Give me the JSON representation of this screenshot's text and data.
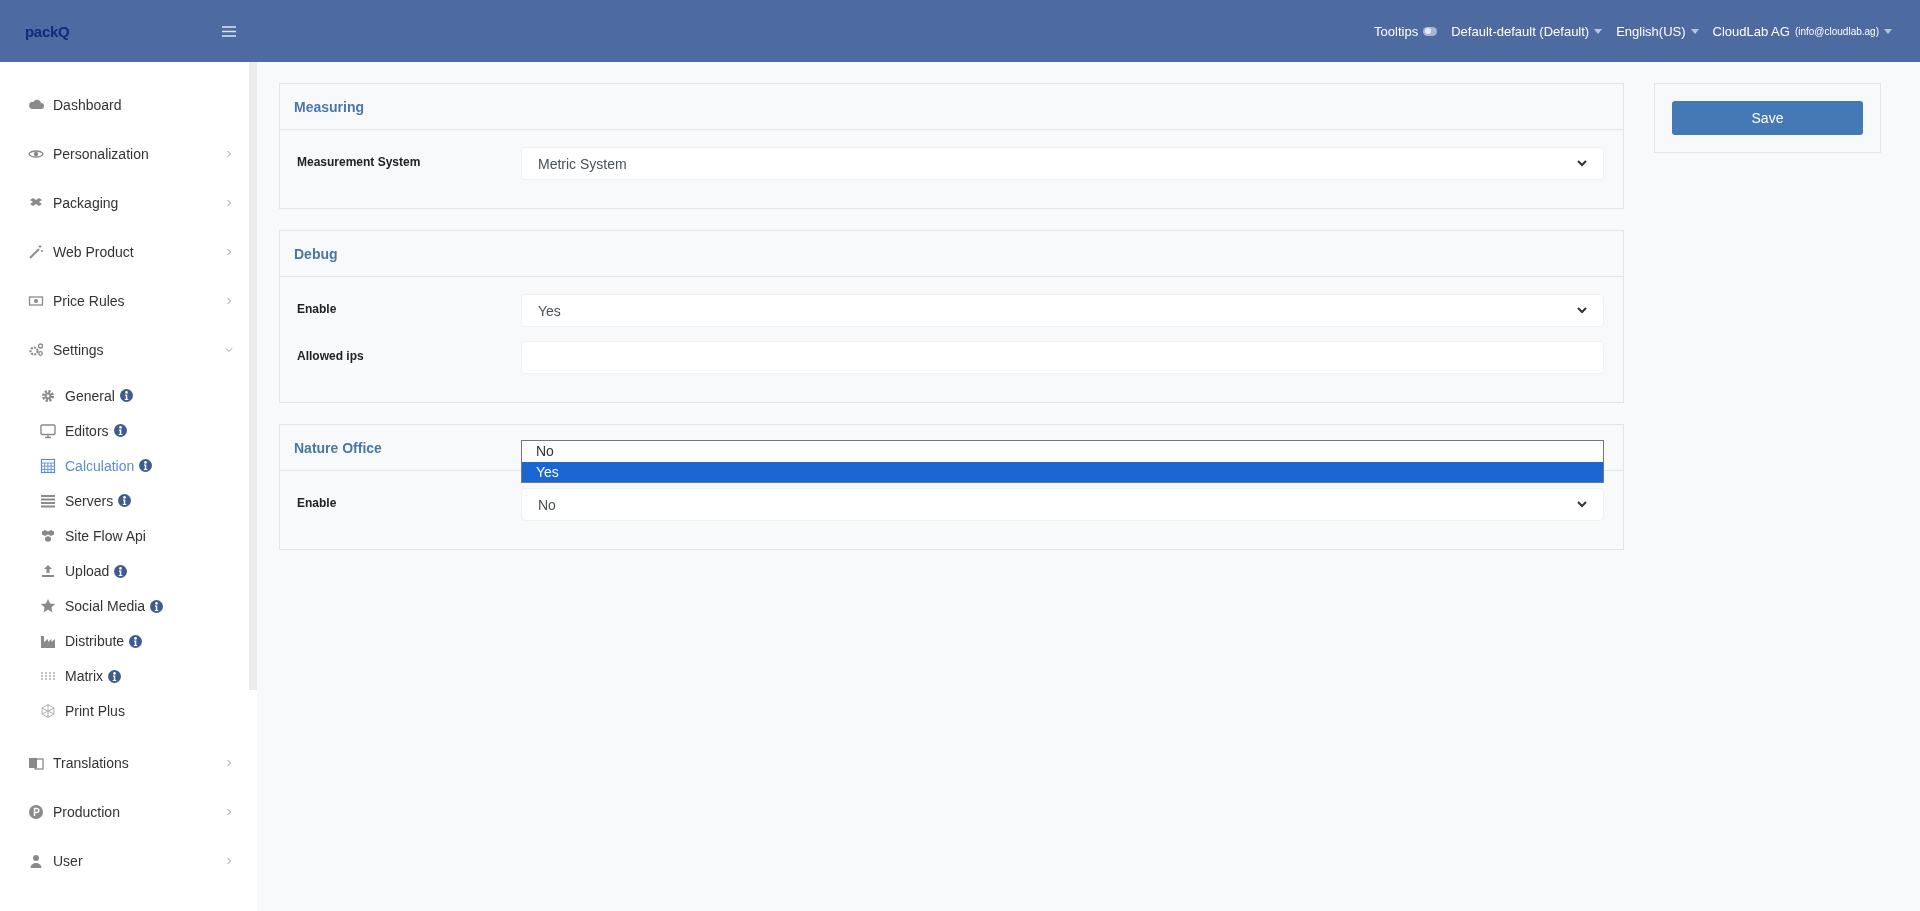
{
  "header": {
    "logo": "packQ",
    "tooltips": {
      "label": "Tooltips",
      "on": false
    },
    "menus": [
      {
        "label": "Default-default (Default)"
      },
      {
        "label": "English(US)"
      },
      {
        "label": "CloudLab AG",
        "detail": "(info@cloudlab.ag)"
      }
    ]
  },
  "sidebar": {
    "items": [
      {
        "label": "Dashboard"
      },
      {
        "label": "Personalization",
        "expanded": false
      },
      {
        "label": "Packaging",
        "expanded": false
      },
      {
        "label": "Web Product",
        "expanded": false
      },
      {
        "label": "Price Rules",
        "expanded": false
      },
      {
        "label": "Settings",
        "expanded": true,
        "children": [
          {
            "label": "General",
            "info": true,
            "selected": false
          },
          {
            "label": "Editors",
            "info": true,
            "selected": false
          },
          {
            "label": "Calculation",
            "info": true,
            "selected": true
          },
          {
            "label": "Servers",
            "info": true,
            "selected": false
          },
          {
            "label": "Site Flow Api",
            "info": false,
            "selected": false
          },
          {
            "label": "Upload",
            "info": true,
            "selected": false
          },
          {
            "label": "Social Media",
            "info": true,
            "selected": false
          },
          {
            "label": "Distribute",
            "info": true,
            "selected": false
          },
          {
            "label": "Matrix",
            "info": true,
            "selected": false
          },
          {
            "label": "Print Plus",
            "info": false,
            "selected": false
          }
        ]
      },
      {
        "label": "Translations",
        "expanded": false
      },
      {
        "label": "Production",
        "expanded": false
      },
      {
        "label": "User",
        "expanded": false
      }
    ]
  },
  "sections": [
    {
      "title": "Measuring",
      "fields": [
        {
          "label": "Measurement System",
          "kind": "select",
          "value": "Metric System"
        }
      ]
    },
    {
      "title": "Debug",
      "fields": [
        {
          "label": "Enable",
          "kind": "select",
          "value": "Yes"
        },
        {
          "label": "Allowed ips",
          "kind": "text"
        }
      ]
    },
    {
      "title": "Nature Office",
      "fields": [
        {
          "label": "Enable",
          "kind": "select",
          "value": "No",
          "dropdown": [
            {
              "label": "No",
              "highlighted": false
            },
            {
              "label": "Yes",
              "highlighted": true
            }
          ]
        }
      ]
    }
  ],
  "save_button": "Save"
}
